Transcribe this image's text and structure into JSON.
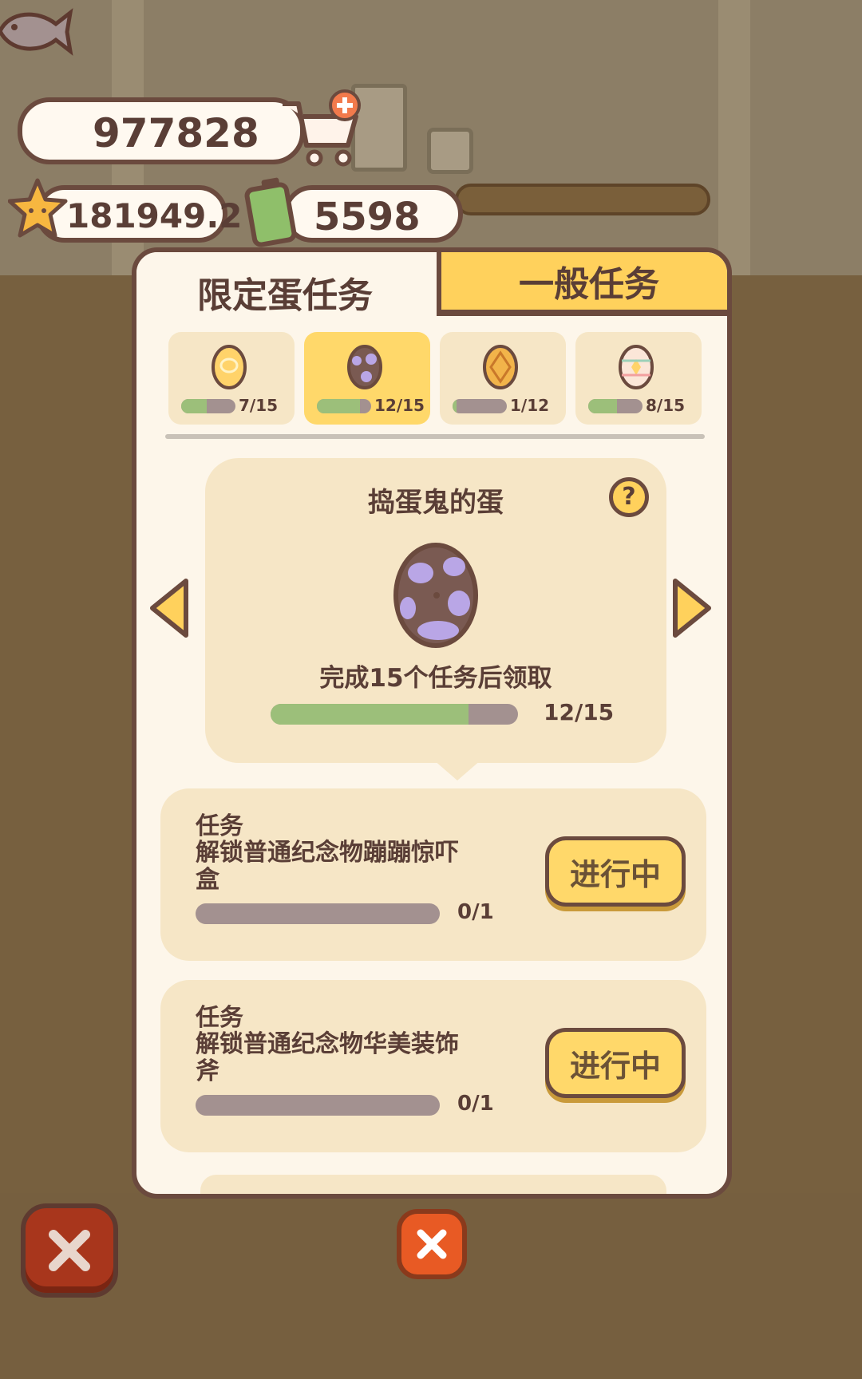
{
  "currency": {
    "fish": "977828",
    "stars": "181949.2",
    "battery": "5598"
  },
  "tabs": {
    "limited": "限定蛋任务",
    "general": "一般任务"
  },
  "egg_tabs": [
    {
      "count": "7/15",
      "progress": 0.47,
      "selected": false,
      "color": "#ffd36a"
    },
    {
      "count": "12/15",
      "progress": 0.8,
      "selected": true,
      "color": "#b9a6e6"
    },
    {
      "count": "1/12",
      "progress": 0.08,
      "selected": false,
      "color": "#f2b44a"
    },
    {
      "count": "8/15",
      "progress": 0.53,
      "selected": false,
      "color": "#fbe6d8"
    }
  ],
  "egg_card": {
    "title": "捣蛋鬼的蛋",
    "description": "完成15个任务后领取",
    "count": "12/15",
    "progress": 0.8,
    "help": "?"
  },
  "tasks": [
    {
      "label": "任务",
      "name": "解锁普通纪念物蹦蹦惊吓盒",
      "count": "0/1",
      "button": "进行中"
    },
    {
      "label": "任务",
      "name": "解锁普通纪念物华美装饰斧",
      "count": "0/1",
      "button": "进行中"
    }
  ],
  "colors": {
    "outline": "#6b4a3e",
    "accent_yellow": "#ffd15c",
    "progress_green": "#9cbf7a",
    "progress_track": "#a39190"
  }
}
